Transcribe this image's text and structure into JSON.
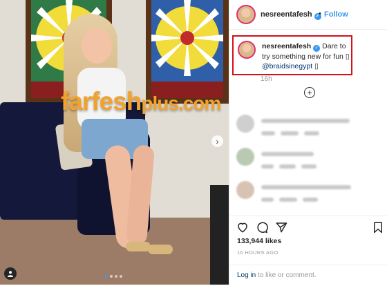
{
  "post": {
    "username": "nesreentafesh",
    "follow_separator": "•",
    "follow_label": "Follow",
    "caption": {
      "username": "nesreentafesh",
      "text": "Dare to try something new for fun ",
      "glyph1": "▯",
      "mention": "@braidsinegypt",
      "glyph2": "▯",
      "time": "16h"
    },
    "likes": "133,944 likes",
    "posted": "16 HOURS AGO",
    "login": {
      "link": "Log in",
      "rest": " to like or comment."
    }
  },
  "watermark": {
    "main": "farfesh",
    "suffix": "plus.com"
  },
  "icons": [
    "verified-icon",
    "heart-icon",
    "comment-icon",
    "share-icon",
    "bookmark-icon",
    "plus-circle-icon",
    "chevron-right-icon",
    "user-tag-icon"
  ],
  "colors": {
    "accent": "#3897f0",
    "highlight_border": "#d4101a",
    "watermark": "#f1a22e"
  },
  "carousel": {
    "slides": 4,
    "active": 1
  }
}
